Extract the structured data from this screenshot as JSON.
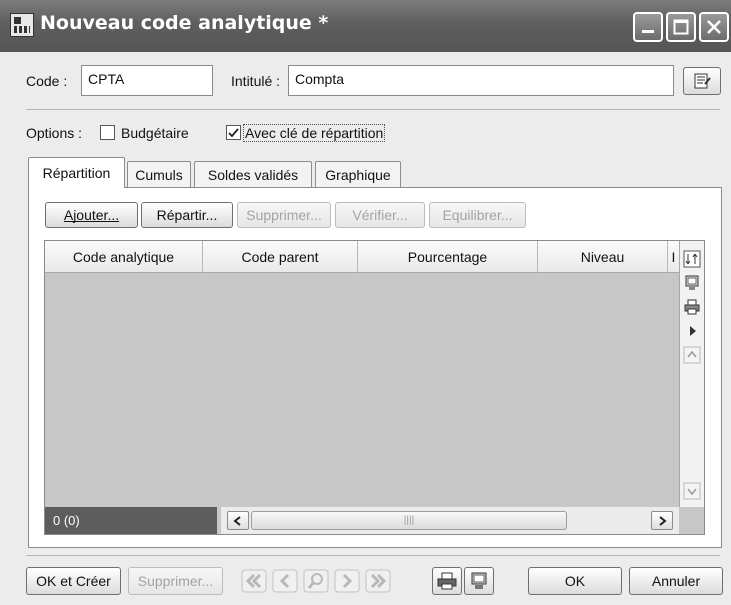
{
  "window": {
    "title": "Nouveau code analytique *"
  },
  "fields": {
    "code_label": "Code :",
    "code_value": "CPTA",
    "intitule_label": "Intitulé :",
    "intitule_value": "Compta"
  },
  "options": {
    "label": "Options :",
    "budgetaire": {
      "label": "Budgétaire",
      "checked": false
    },
    "avec_cle": {
      "label": "Avec clé de répartition",
      "checked": true
    }
  },
  "tabs": [
    {
      "label": "Répartition",
      "active": true
    },
    {
      "label": "Cumuls"
    },
    {
      "label": "Soldes validés"
    },
    {
      "label": "Graphique"
    }
  ],
  "toolbar": {
    "ajouter": "Ajouter...",
    "repartir": "Répartir...",
    "supprimer": "Supprimer...",
    "verifier": "Vérifier...",
    "equilibrer": "Equilibrer..."
  },
  "grid": {
    "columns": [
      "Code analytique",
      "Code parent",
      "Pourcentage",
      "Niveau",
      "I"
    ],
    "rows": [],
    "status": "0 (0)"
  },
  "footer": {
    "ok_creer": "OK et Créer",
    "supprimer": "Supprimer...",
    "ok": "OK",
    "annuler": "Annuler"
  },
  "colors": {
    "titlebar": "#606060",
    "panel": "#ffffff",
    "grid_bg": "#c7c7c7",
    "status_bg": "#5d5d5d"
  }
}
